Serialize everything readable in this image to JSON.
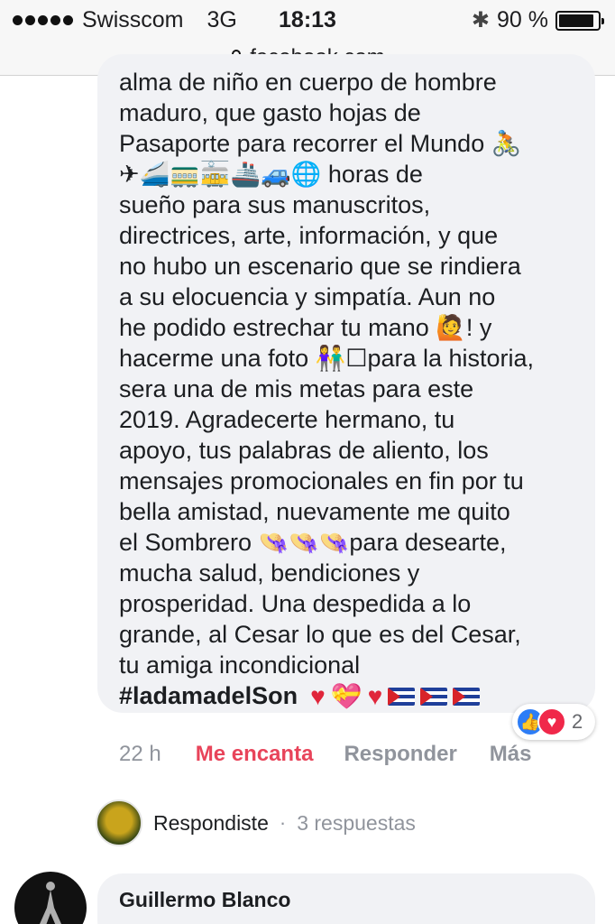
{
  "status_bar": {
    "carrier": "Swisscom",
    "network": "3G",
    "time": "18:13",
    "battery_text": "90 %",
    "battery_level": 0.9,
    "signal_bars": 5,
    "icons": [
      "signal-dots-icon",
      "bluetooth-icon",
      "battery-icon"
    ]
  },
  "browser": {
    "url": "facebook.com",
    "icon": "lock-icon"
  },
  "comment": {
    "lines": [
      "alma de niño en cuerpo de hombre",
      "maduro, que gasto hojas de",
      "Pasaporte para recorrer el Mundo 🚴",
      "✈🚄🚃🚋🚢🚙🌐 horas de",
      "sueño para sus manuscritos,",
      "directrices, arte, información, y que",
      "no hubo un escenario que se rindiera",
      "a su elocuencia y simpatía. Aun no",
      "he podido estrechar tu mano 🙋!    y",
      "hacerme una foto 👫☐para la historia,",
      "sera una de mis metas para este",
      "2019. Agradecerte hermano, tu",
      "apoyo, tus palabras de aliento, los",
      "mensajes promocionales en fin por tu",
      "bella amistad, nuevamente me quito",
      "el Sombrero  👒👒👒para desearte,",
      "mucha salud, bendiciones y",
      "prosperidad. Una despedida a lo",
      "grande, al Cesar lo que es del Cesar,",
      "tu amiga incondicional"
    ],
    "hashtag": "#ladamadelSon",
    "hashtag_emojis": [
      "heart-emoji",
      "gift-heart-emoji",
      "heart-emoji",
      "cuba-flag-emoji",
      "cuba-flag-emoji",
      "cuba-flag-emoji"
    ],
    "reactions": {
      "icons": [
        "like-reaction-icon",
        "love-reaction-icon"
      ],
      "count": "2"
    },
    "actions": {
      "time": "22 h",
      "love": "Me encanta",
      "reply": "Responder",
      "more": "Más"
    }
  },
  "reply_summary": {
    "label": "Respondiste",
    "separator": "·",
    "count_text": "3 respuestas"
  },
  "next_comment": {
    "author": "Guillermo Blanco"
  },
  "colors": {
    "bubble_bg": "#f1f2f5",
    "love_red": "#e8445a",
    "secondary_gray": "#90949c",
    "like_blue": "#2d7df6"
  }
}
